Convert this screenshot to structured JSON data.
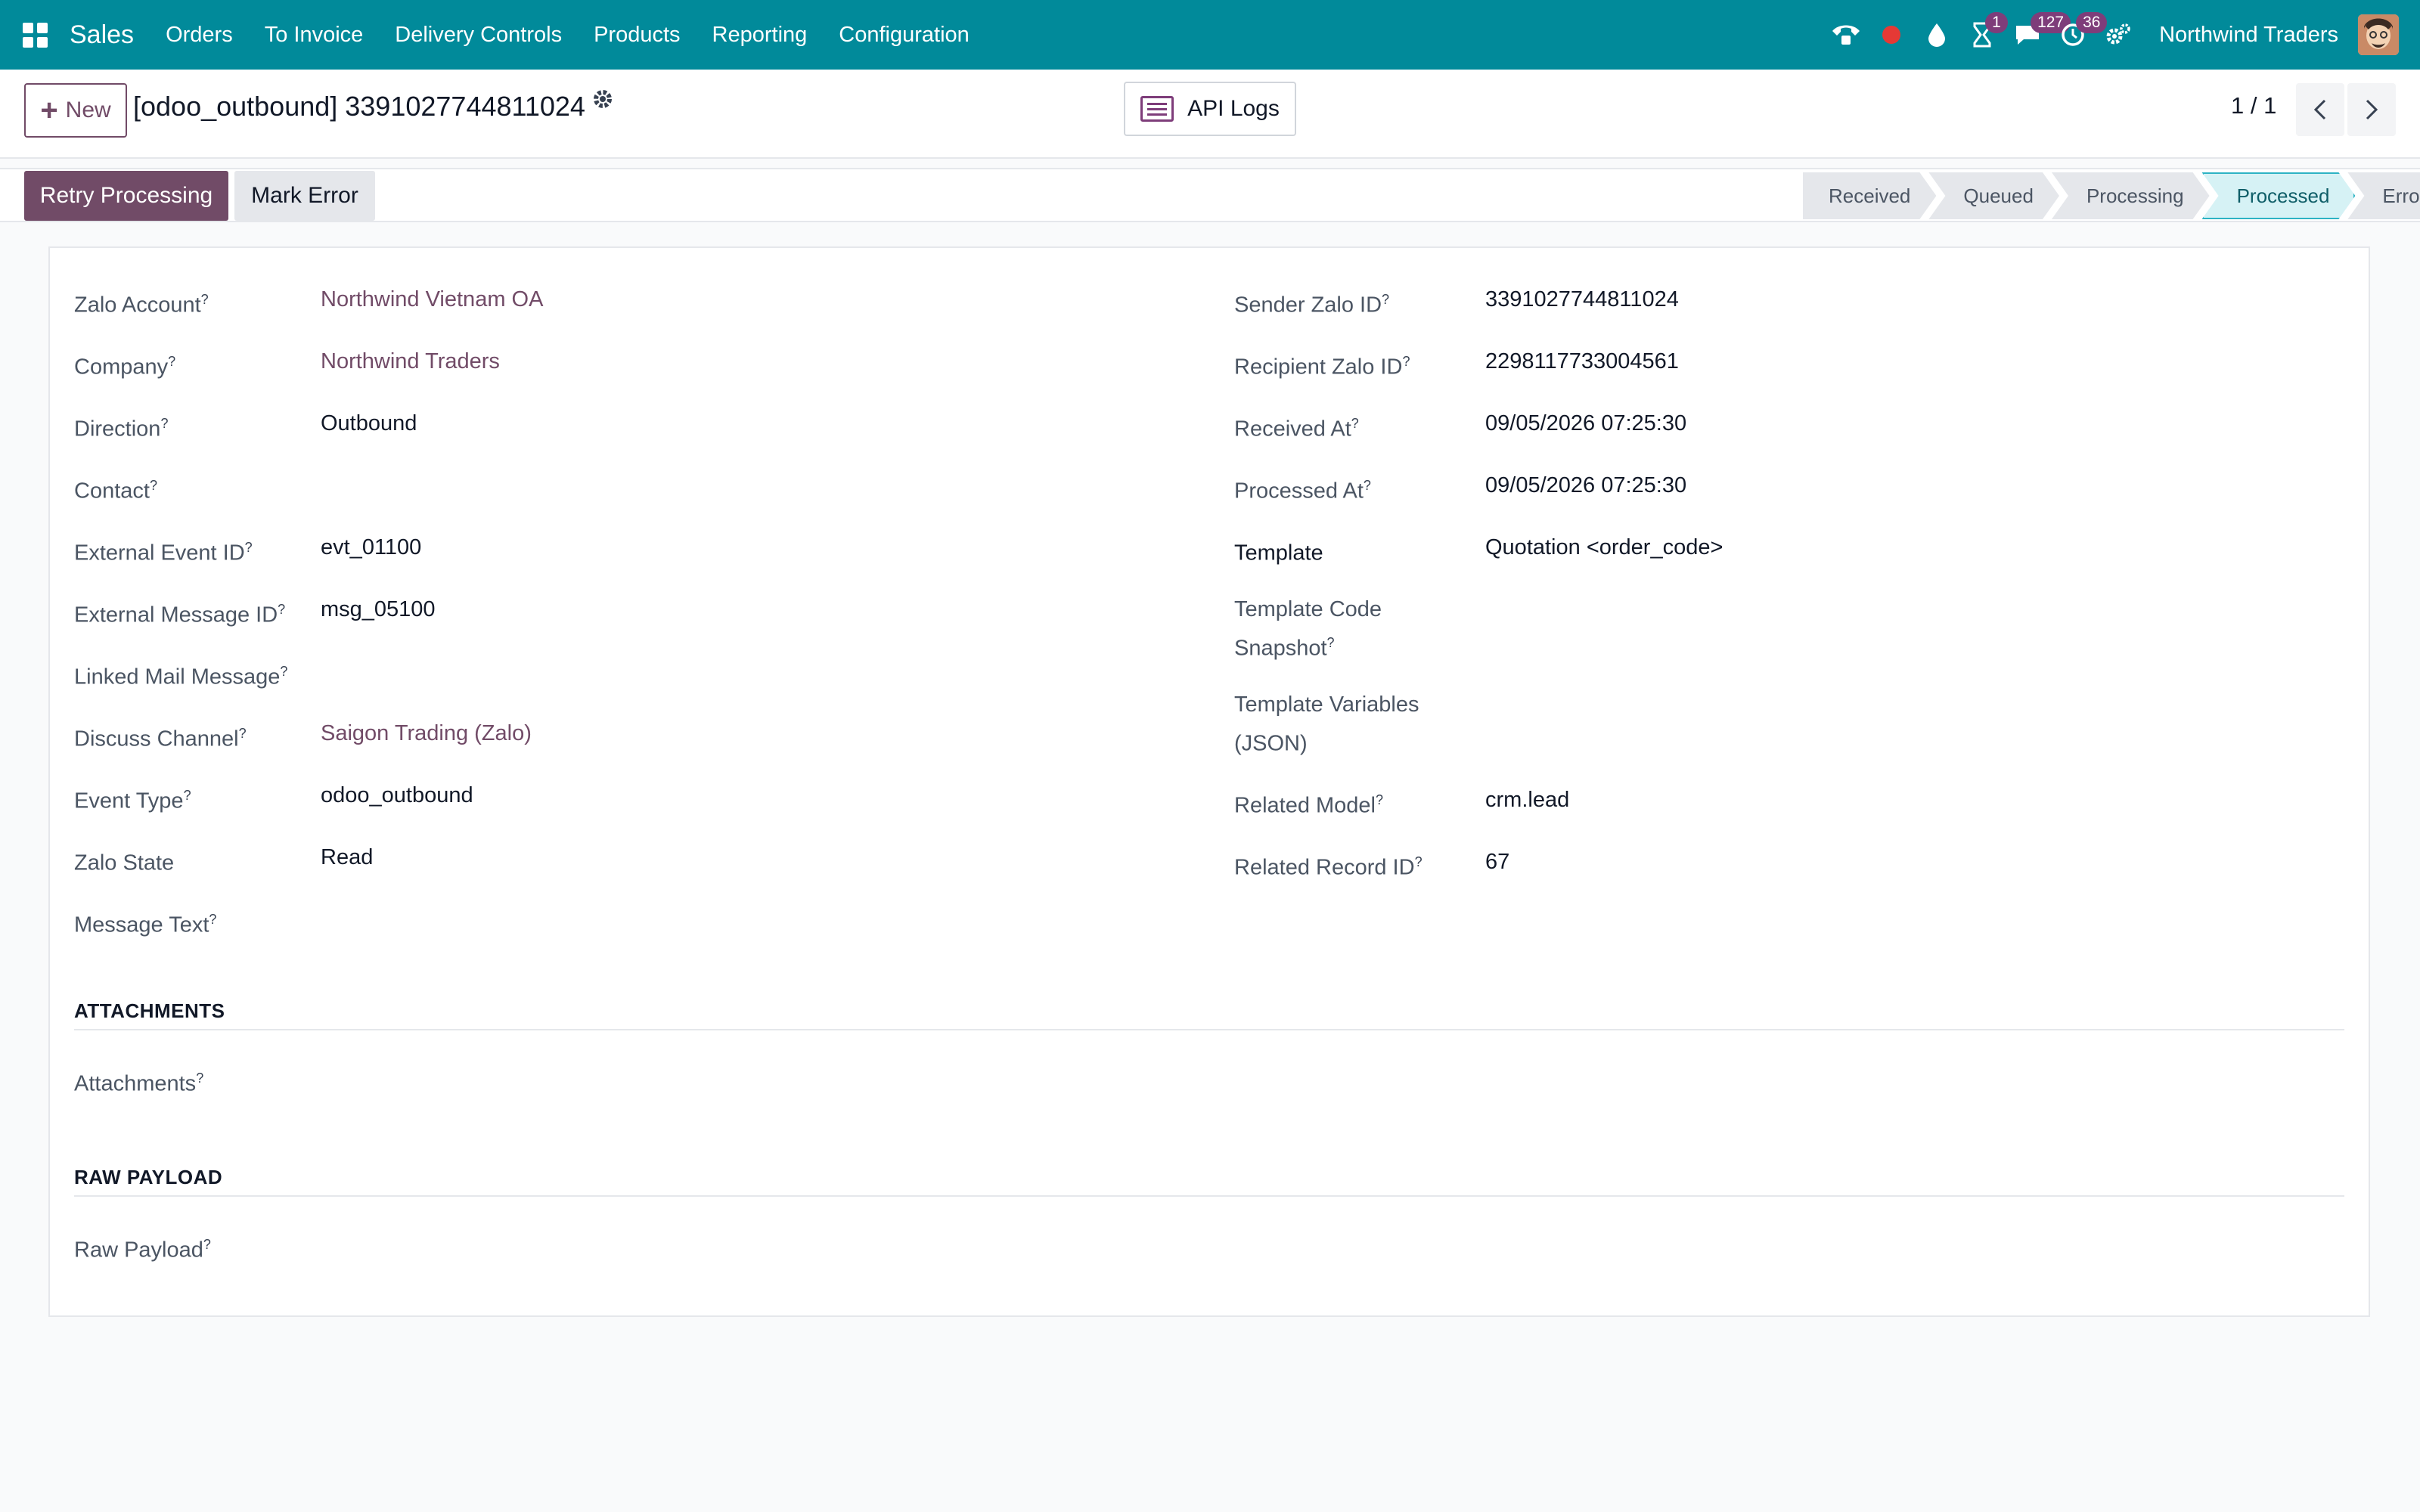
{
  "navbar": {
    "brand": "Sales",
    "menu": [
      "Orders",
      "To Invoice",
      "Delivery Controls",
      "Products",
      "Reporting",
      "Configuration"
    ],
    "activity_badge": "1",
    "messages_badge": "127",
    "clock_badge": "36",
    "company": "Northwind Traders"
  },
  "control": {
    "new_label": "New",
    "title": "[odoo_outbound] 3391027744811024",
    "api_logs_label": "API Logs",
    "pager": "1 / 1"
  },
  "statusbar": {
    "retry_label": "Retry Processing",
    "mark_error_label": "Mark Error",
    "stages": [
      "Received",
      "Queued",
      "Processing",
      "Processed",
      "Error"
    ],
    "active_stage": "Processed"
  },
  "fields_left": [
    {
      "label": "Zalo Account",
      "help": "?",
      "value": "Northwind Vietnam OA"
    },
    {
      "label": "Company",
      "help": "?",
      "value": "Northwind Traders"
    },
    {
      "label": "Direction",
      "help": "?",
      "value": "Outbound"
    },
    {
      "label": "Contact",
      "help": "?",
      "value": ""
    },
    {
      "label": "External Event ID",
      "help": "?",
      "value": "evt_01100"
    },
    {
      "label": "External Message ID",
      "help": "?",
      "value": "msg_05100"
    },
    {
      "label": "Linked Mail Message",
      "help": "?",
      "value": ""
    },
    {
      "label": "Discuss Channel",
      "help": "?",
      "value": "Saigon Trading (Zalo)"
    },
    {
      "label": "Event Type",
      "help": "?",
      "value": "odoo_outbound"
    },
    {
      "label": "Zalo State",
      "help": "",
      "value": "Read"
    },
    {
      "label": "Message Text",
      "help": "?",
      "value": ""
    }
  ],
  "fields_right": [
    {
      "label": "Sender Zalo ID",
      "help": "?",
      "value": "3391027744811024"
    },
    {
      "label": "Recipient Zalo ID",
      "help": "?",
      "value": "2298117733004561"
    },
    {
      "label": "Received At",
      "help": "?",
      "value": "09/05/2026 07:25:30"
    },
    {
      "label": "Processed At",
      "help": "?",
      "value": "09/05/2026 07:25:30"
    },
    {
      "label": "Template",
      "help": "",
      "value": "Quotation <order_code>"
    },
    {
      "label": "Template Code Snapshot",
      "help": "?",
      "value": ""
    },
    {
      "label": "Template Variables (JSON)",
      "help": "",
      "value": ""
    },
    {
      "label": "Related Model",
      "help": "?",
      "value": "crm.lead"
    },
    {
      "label": "Related Record ID",
      "help": "?",
      "value": "67"
    }
  ],
  "sections": {
    "attachments_title": "ATTACHMENTS",
    "attachments_label": "Attachments",
    "attachments_help": "?",
    "raw_title": "RAW PAYLOAD",
    "raw_label": "Raw Payload",
    "raw_help": "?"
  }
}
